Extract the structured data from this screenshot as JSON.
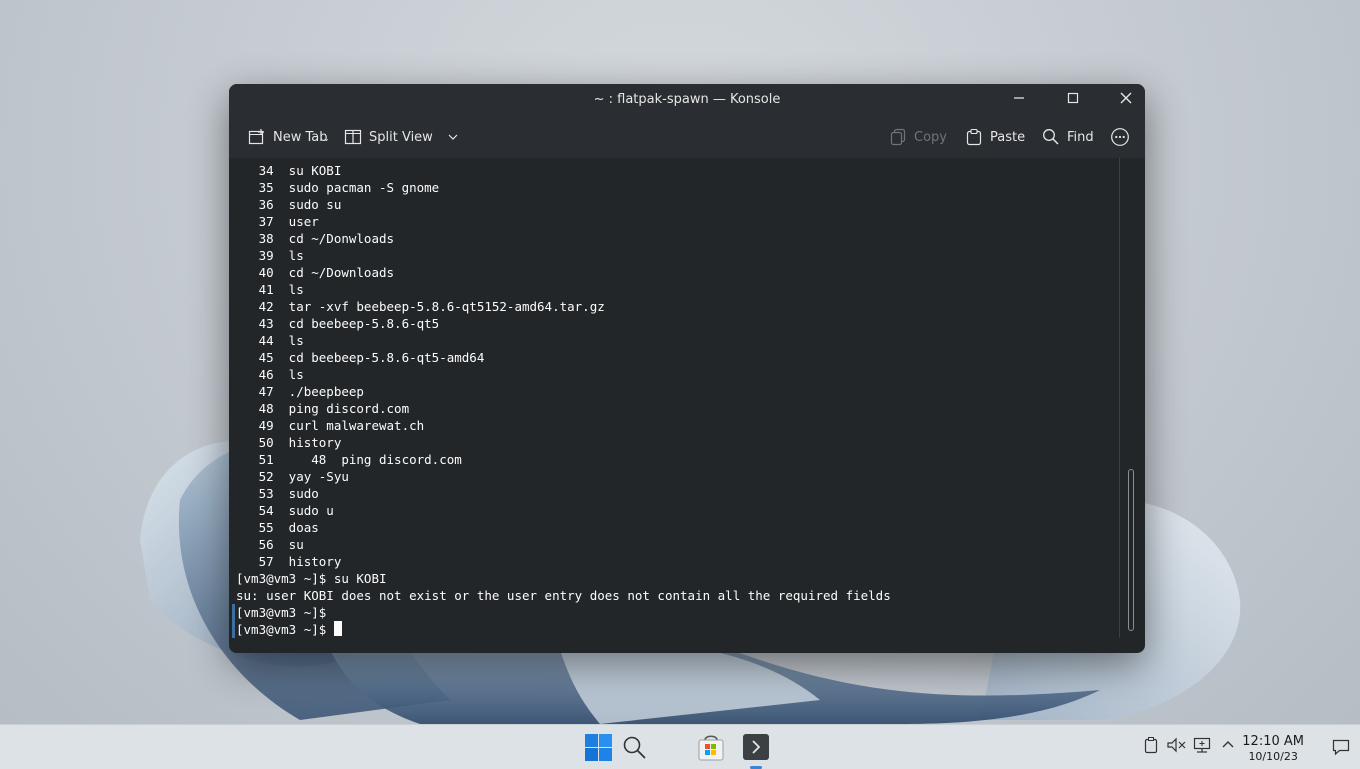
{
  "window": {
    "title": "~ : flatpak-spawn — Konsole",
    "minimize_icon": "minimize-icon",
    "maximize_icon": "maximize-icon",
    "close_icon": "close-icon"
  },
  "toolbar": {
    "new_tab": "New Tab",
    "split_view": "Split View",
    "copy": "Copy",
    "paste": "Paste",
    "find": "Find",
    "more_icon": "more-icon"
  },
  "terminal": {
    "lines": [
      "   34  su KOBI",
      "   35  sudo pacman -S gnome",
      "   36  sudo su",
      "   37  user",
      "   38  cd ~/Donwloads",
      "   39  ls",
      "   40  cd ~/Downloads",
      "   41  ls",
      "   42  tar -xvf beebeep-5.8.6-qt5152-amd64.tar.gz",
      "   43  cd beebeep-5.8.6-qt5",
      "   44  ls",
      "   45  cd beebeep-5.8.6-qt5-amd64",
      "   46  ls",
      "   47  ./beepbeep",
      "   48  ping discord.com",
      "   49  curl malwarewat.ch",
      "   50  history",
      "   51     48  ping discord.com",
      "   52  yay -Syu",
      "   53  sudo",
      "   54  sudo u",
      "   55  doas",
      "   56  su",
      "   57  history",
      "[vm3@vm3 ~]$ su KOBI",
      "su: user KOBI does not exist or the user entry does not contain all the required fields",
      "[vm3@vm3 ~]$",
      "[vm3@vm3 ~]$ "
    ]
  },
  "taskbar": {
    "start_icon": "windows-start-icon",
    "search_icon": "search-icon",
    "store_icon": "store-icon",
    "terminal_icon": "terminal-icon",
    "time": "12:10 AM",
    "date": "10/10/23"
  }
}
